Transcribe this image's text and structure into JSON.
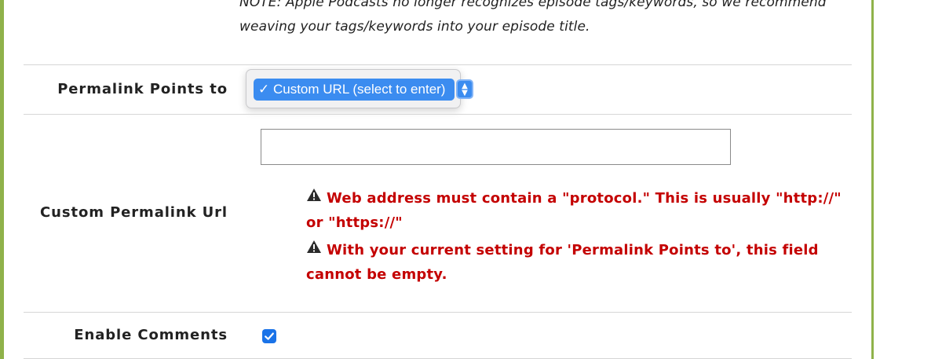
{
  "note": {
    "text": "NOTE: Apple Podcasts no longer recognizes episode tags/keywords, so we recommend weaving your tags/keywords into your episode title."
  },
  "permalink_points_to": {
    "label": "Permalink Points to",
    "selected_option": "✓ Custom URL (select to enter)"
  },
  "custom_permalink_url": {
    "label": "Custom Permalink Url",
    "value": "",
    "errors": [
      "Web address must contain a \"protocol.\" This is usually \"http://\" or \"https://\"",
      "With your current setting for 'Permalink Points to', this field cannot be empty."
    ]
  },
  "enable_comments": {
    "label": "Enable Comments",
    "checked": true
  },
  "colors": {
    "border_accent": "#8fb24a",
    "error_text": "#c40000",
    "select_highlight": "#3b8cf0",
    "checkbox": "#1a73e8"
  }
}
